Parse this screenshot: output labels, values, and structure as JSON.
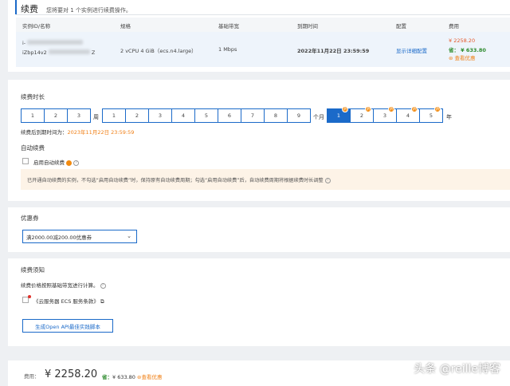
{
  "header": {
    "title": "续费",
    "subtitle": "您将要对 1 个实例进行续费操作。"
  },
  "table": {
    "columns": [
      "实例ID/名称",
      "规格",
      "基础带宽",
      "到期时间",
      "配置",
      "费用"
    ],
    "row": {
      "id_prefix": "i-",
      "name_prefix": "iZbp14v2",
      "name_suffix": "Z",
      "spec": "2 vCPU 4 GiB（ecs.n4.large）",
      "bandwidth": "1 Mbps",
      "expire": "2022年11月22日 23:59:59",
      "config_link": "显示详细配置",
      "price": "¥ 2258.20",
      "save_label": "省：",
      "save_amount": "¥ 633.80",
      "view_discount": "查看优惠"
    }
  },
  "duration": {
    "label": "续费时长",
    "weeks": [
      "1",
      "2",
      "3"
    ],
    "week_unit": "周",
    "months": [
      "1",
      "2",
      "3",
      "4",
      "5",
      "6",
      "7",
      "8",
      "9"
    ],
    "month_unit": "个月",
    "years": [
      "1",
      "2",
      "3",
      "4",
      "5"
    ],
    "year_unit": "年",
    "selected_year": "1",
    "expiry_label": "续费后到期时间为：",
    "expiry_value": "2023年11月22日 23:59:59",
    "auto_renew_label": "自动续费",
    "auto_renew_checkbox": "启用自动续费",
    "warning": "已开通自动续费的实例，不勾选“启用自动续费”时，保持原有自动续费周期；勾选“启用自动续费”后，自动续费周期将根据续费时长调整"
  },
  "coupon": {
    "label": "优惠券",
    "selected": "满2000.00减200.00优惠券"
  },
  "notice": {
    "label": "续费须知",
    "text": "续费价格按照基础带宽进行计算。",
    "terms_link": "《云服务器 ECS 服务条款》",
    "api_button": "生成Open API最佳实践脚本"
  },
  "footer": {
    "fee_label": "费用：",
    "fee_value": "¥ 2258.20",
    "save_label": "省：",
    "save_value": "¥ 633.80",
    "view_discount": "查看优惠"
  },
  "watermark": "头条 @reille博客",
  "colors": {
    "primary": "#1b6ac9",
    "price": "#e5582a",
    "discount_badge": "#f28a0f",
    "expiry": "#f07f15",
    "save": "#2e8b2e"
  }
}
